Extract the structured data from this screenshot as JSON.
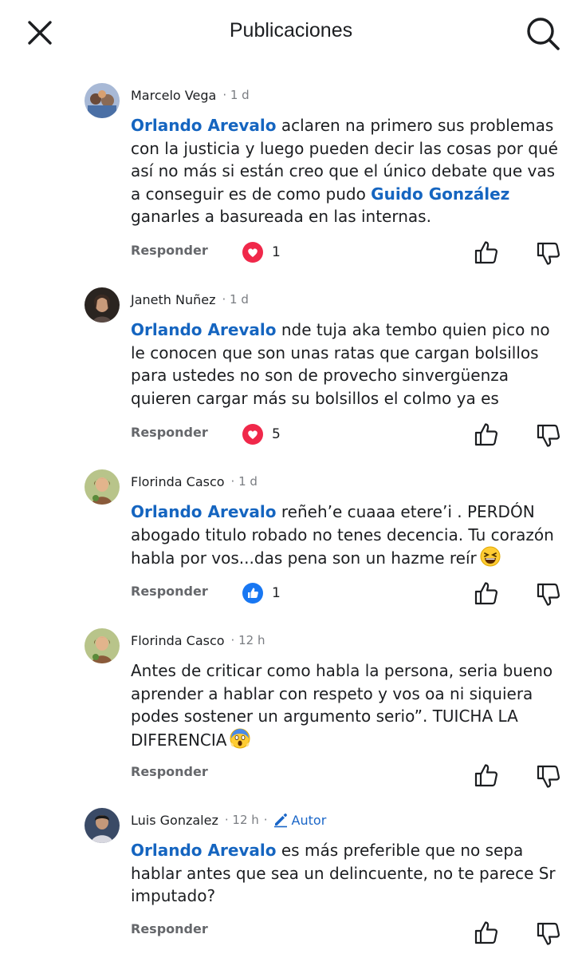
{
  "header": {
    "title": "Publicaciones",
    "close_icon": "close-icon",
    "search_icon": "search-icon"
  },
  "colors": {
    "mention": "#1565c0",
    "love": "#f0284a",
    "like": "#1877f2",
    "muted": "#65676b"
  },
  "comments": [
    {
      "author": "Marcelo Vega",
      "time": "· 1 d",
      "mention_1": "Orlando Arevalo",
      "text_1": " aclaren na primero sus problemas con la justicia y luego pueden decir las cosas por qué así no más si están creo que el único debate que vas a conseguir es de como pudo ",
      "mention_2": "Guido González",
      "text_2": " ganarles a basureada en las internas.",
      "reply": "Responder",
      "reaction_icon": "heart-reaction-icon",
      "reaction_count": "1"
    },
    {
      "author": "Janeth Nuñez",
      "time": "· 1 d",
      "mention_1": "Orlando Arevalo",
      "text_1": " nde tuja aka tembo quien pico no le conocen que son unas ratas que cargan bolsillos para ustedes no son de provecho sinvergüenza quieren cargar más su bolsillos el colmo ya es",
      "reply": "Responder",
      "reaction_icon": "heart-reaction-icon",
      "reaction_count": "5"
    },
    {
      "author": "Florinda Casco",
      "time": "· 1 d",
      "mention_1": "Orlando Arevalo",
      "text_1": " reñeh’e cuaaa etere’i . PERDÓN abogado titulo robado no tenes decencia. Tu corazón habla por vos...das pena son un hazme reír",
      "emoji": "laughing-emoji",
      "reply": "Responder",
      "reaction_icon": "like-reaction-icon",
      "reaction_count": "1"
    },
    {
      "author": "Florinda Casco",
      "time": "· 12 h",
      "text_1": "Antes de criticar como habla la persona, seria bueno aprender a hablar con respeto y vos oa ni siquiera podes sostener un argumento serio”. TUICHA LA DIFERENCIA",
      "emoji": "screaming-emoji",
      "reply": "Responder"
    },
    {
      "author": "Luis Gonzalez",
      "time": "· 12 h",
      "badge_separator": "·",
      "badge": "Autor",
      "mention_1": "Orlando Arevalo",
      "text_1": " es más preferible que no sepa hablar antes que sea un delincuente, no te parece Sr imputado?",
      "reply": "Responder"
    }
  ]
}
